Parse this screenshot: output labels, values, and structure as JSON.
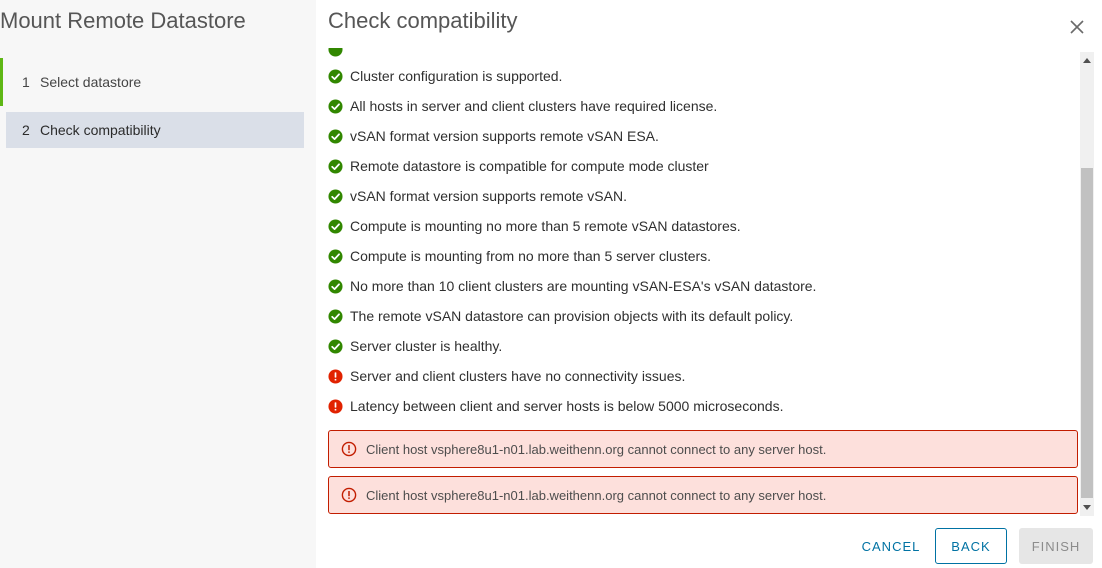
{
  "wizard": {
    "title": "Mount Remote Datastore",
    "steps": [
      {
        "number": "1",
        "label": "Select datastore",
        "state": "done"
      },
      {
        "number": "2",
        "label": "Check compatibility",
        "state": "active"
      }
    ]
  },
  "page": {
    "title": "Check compatibility"
  },
  "checks": [
    {
      "status": "success",
      "text": "Cluster configuration is supported."
    },
    {
      "status": "success",
      "text": "All hosts in server and client clusters have required license."
    },
    {
      "status": "success",
      "text": "vSAN format version supports remote vSAN ESA."
    },
    {
      "status": "success",
      "text": "Remote datastore is compatible for compute mode cluster"
    },
    {
      "status": "success",
      "text": "vSAN format version supports remote vSAN."
    },
    {
      "status": "success",
      "text": "Compute is mounting no more than 5 remote vSAN datastores."
    },
    {
      "status": "success",
      "text": "Compute is mounting from no more than 5 server clusters."
    },
    {
      "status": "success",
      "text": "No more than 10 client clusters are mounting vSAN-ESA's vSAN datastore."
    },
    {
      "status": "success",
      "text": "The remote vSAN datastore can provision objects with its default policy."
    },
    {
      "status": "success",
      "text": "Server cluster is healthy."
    },
    {
      "status": "error",
      "text": "Server and client clusters have no connectivity issues."
    },
    {
      "status": "error",
      "text": "Latency between client and server hosts is below 5000 microseconds."
    }
  ],
  "alerts": [
    {
      "icon": "exclamation-circle-icon",
      "text": "Client host vsphere8u1-n01.lab.weithenn.org cannot connect to any server host."
    },
    {
      "icon": "exclamation-circle-icon",
      "text": "Client host vsphere8u1-n01.lab.weithenn.org cannot connect to any server host."
    }
  ],
  "buttons": {
    "cancel": "CANCEL",
    "back": "BACK",
    "finish": "FINISH"
  },
  "icons": {
    "success": "check-circle-icon",
    "error": "exclamation-circle-icon",
    "close": "close-icon"
  },
  "colors": {
    "success": "#318700",
    "error": "#e12200",
    "alert_border": "#c21d00",
    "alert_bg": "#fde0dc",
    "primary": "#0072a3",
    "step_done": "#5eb715",
    "step_active_bg": "#dadfe8"
  }
}
